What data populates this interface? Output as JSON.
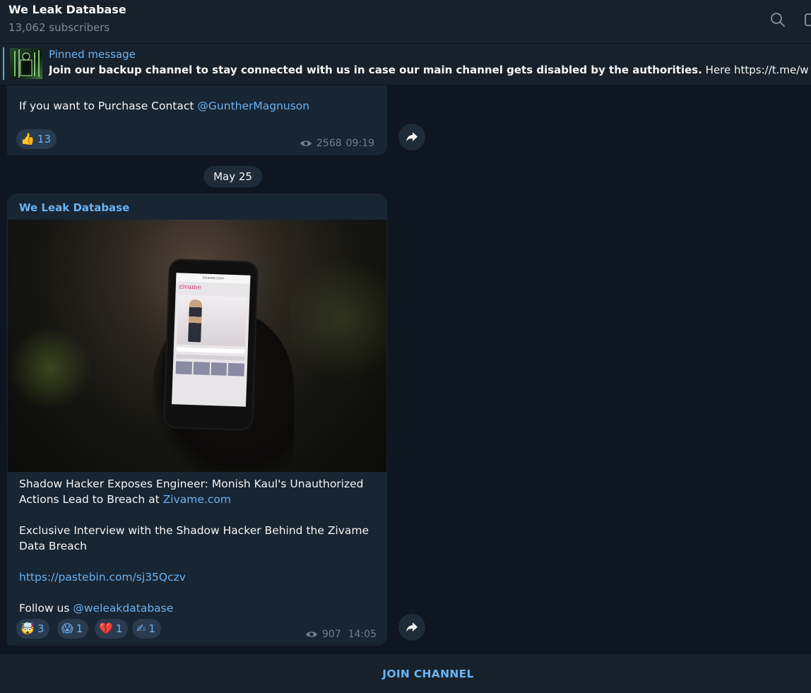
{
  "header": {
    "title": "We Leak Database",
    "subtitle": "13,062 subscribers",
    "search_icon": "search-icon",
    "more_icon": "more-icon"
  },
  "pinned": {
    "label": "Pinned message",
    "text_bold": "Join our backup channel to stay connected with us in case our main channel gets disabled by the authorities.",
    "text_rest": "  Here  https://t.me/weleakdatab..."
  },
  "messages": [
    {
      "text_prefix": "If you want to Purchase Contact ",
      "mention": "@GuntherMagnuson",
      "reactions": [
        {
          "emoji": "👍",
          "count": "13"
        }
      ],
      "views": "2568",
      "time": "09:19"
    },
    {
      "sender": "We Leak Database",
      "headline_prefix": "Shadow Hacker Exposes Engineer: Monish Kaul's Unauthorized Actions Lead to Breach at ",
      "headline_link": "Zivame.com",
      "paragraph2": "Exclusive Interview with the Shadow Hacker Behind the Zivame Data Breach",
      "url": "https://pastebin.com/sj35Qczv",
      "follow_prefix": "Follow us ",
      "follow_mention": "@weleakdatabase",
      "reactions": [
        {
          "emoji": "🤯",
          "count": "3"
        },
        {
          "emoji": "😱",
          "count": "1"
        },
        {
          "emoji": "💔",
          "count": "1"
        },
        {
          "emoji": "✍",
          "count": "1"
        }
      ],
      "views": "907",
      "time": "14:05",
      "photo": {
        "url_text": "zivame.com",
        "brand": "zivame"
      }
    }
  ],
  "date_separator": "May 25",
  "join_label": "JOIN CHANNEL"
}
